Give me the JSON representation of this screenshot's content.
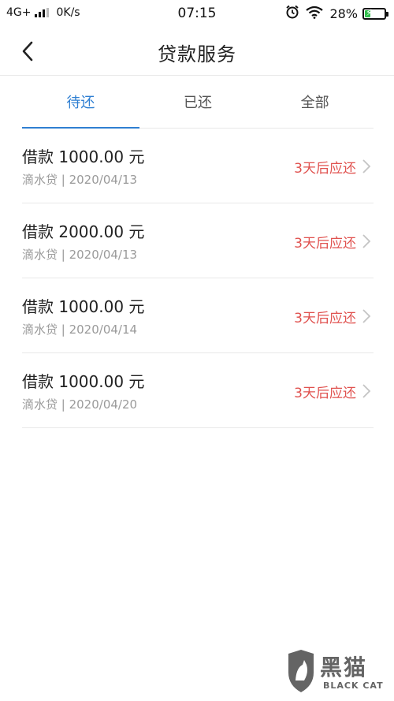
{
  "status_bar": {
    "network": "4G+",
    "speed": "0K/s",
    "time": "07:15",
    "battery_percent": "28%",
    "battery_level": 0.28,
    "icons": [
      "signal-icon",
      "alarm-icon",
      "wifi-icon",
      "battery-icon"
    ]
  },
  "nav": {
    "title": "贷款服务",
    "back_icon": "chevron-left-icon"
  },
  "tabs": [
    {
      "label": "待还",
      "active": true
    },
    {
      "label": "已还",
      "active": false
    },
    {
      "label": "全部",
      "active": false
    }
  ],
  "loans": [
    {
      "title": "借款 1000.00 元",
      "subtitle": "滴水贷 | 2020/04/13",
      "status": "3天后应还"
    },
    {
      "title": "借款 2000.00 元",
      "subtitle": "滴水贷 | 2020/04/13",
      "status": "3天后应还"
    },
    {
      "title": "借款 1000.00 元",
      "subtitle": "滴水贷 | 2020/04/14",
      "status": "3天后应还"
    },
    {
      "title": "借款 1000.00 元",
      "subtitle": "滴水贷 | 2020/04/20",
      "status": "3天后应还"
    }
  ],
  "colors": {
    "accent": "#2f7fd2",
    "status": "#e0524f"
  },
  "watermark": {
    "text": "黑猫",
    "sub": "BLACK CAT"
  }
}
